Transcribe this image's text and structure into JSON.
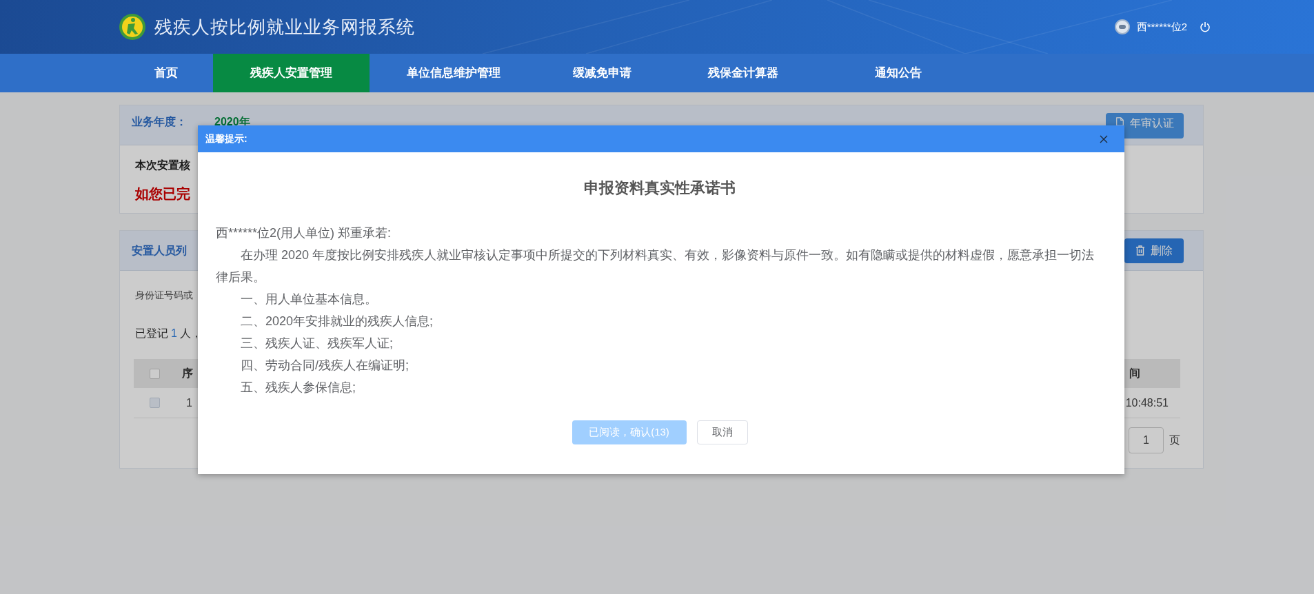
{
  "header": {
    "title": "残疾人按比例就业业务网报系统",
    "user": "西******位2"
  },
  "nav": [
    {
      "label": "首页",
      "selected": false
    },
    {
      "label": "残疾人安置管理",
      "selected": true
    },
    {
      "label": "单位信息维护管理",
      "selected": false
    },
    {
      "label": "缓减免申请",
      "selected": false
    },
    {
      "label": "残保金计算器",
      "selected": false
    },
    {
      "label": "通知公告",
      "selected": false
    }
  ],
  "year_panel": {
    "label": "业务年度：",
    "year": "2020年",
    "button": "年审认证",
    "notice_line_1": "本次安置核",
    "notice_line_2": "如您已完"
  },
  "list_panel": {
    "title": "安置人员列",
    "button": "删除",
    "search_label": "身份证号码或",
    "count_prefix": "已登记",
    "count": "1",
    "count_suffix": "人，",
    "table": {
      "header_checked": false,
      "columns": [
        "序",
        "间"
      ],
      "rows": [
        {
          "checked": false,
          "cells": [
            "1",
            "10:48:51"
          ]
        }
      ]
    },
    "pagination": {
      "page": "1",
      "page_suffix": "页"
    }
  },
  "dialog": {
    "title": "温馨提示:",
    "heading": "申报资料真实性承诺书",
    "intro": "西******位2(用人单位) 郑重承若:",
    "paragraph": "在办理 2020 年度按比例安排残疾人就业审核认定事项中所提交的下列材料真实、有效，影像资料与原件一致。如有隐瞒或提供的材料虚假，愿意承担一切法律后果。",
    "items": [
      "一、用人单位基本信息。",
      "二、2020年安排就业的残疾人信息;",
      "三、残疾人证、残疾军人证;",
      "四、劳动合同/残疾人在编证明;",
      "五、残疾人参保信息;"
    ],
    "confirm": {
      "label": "已阅读，确认(13)",
      "disabled": true
    },
    "cancel": "取消"
  }
}
